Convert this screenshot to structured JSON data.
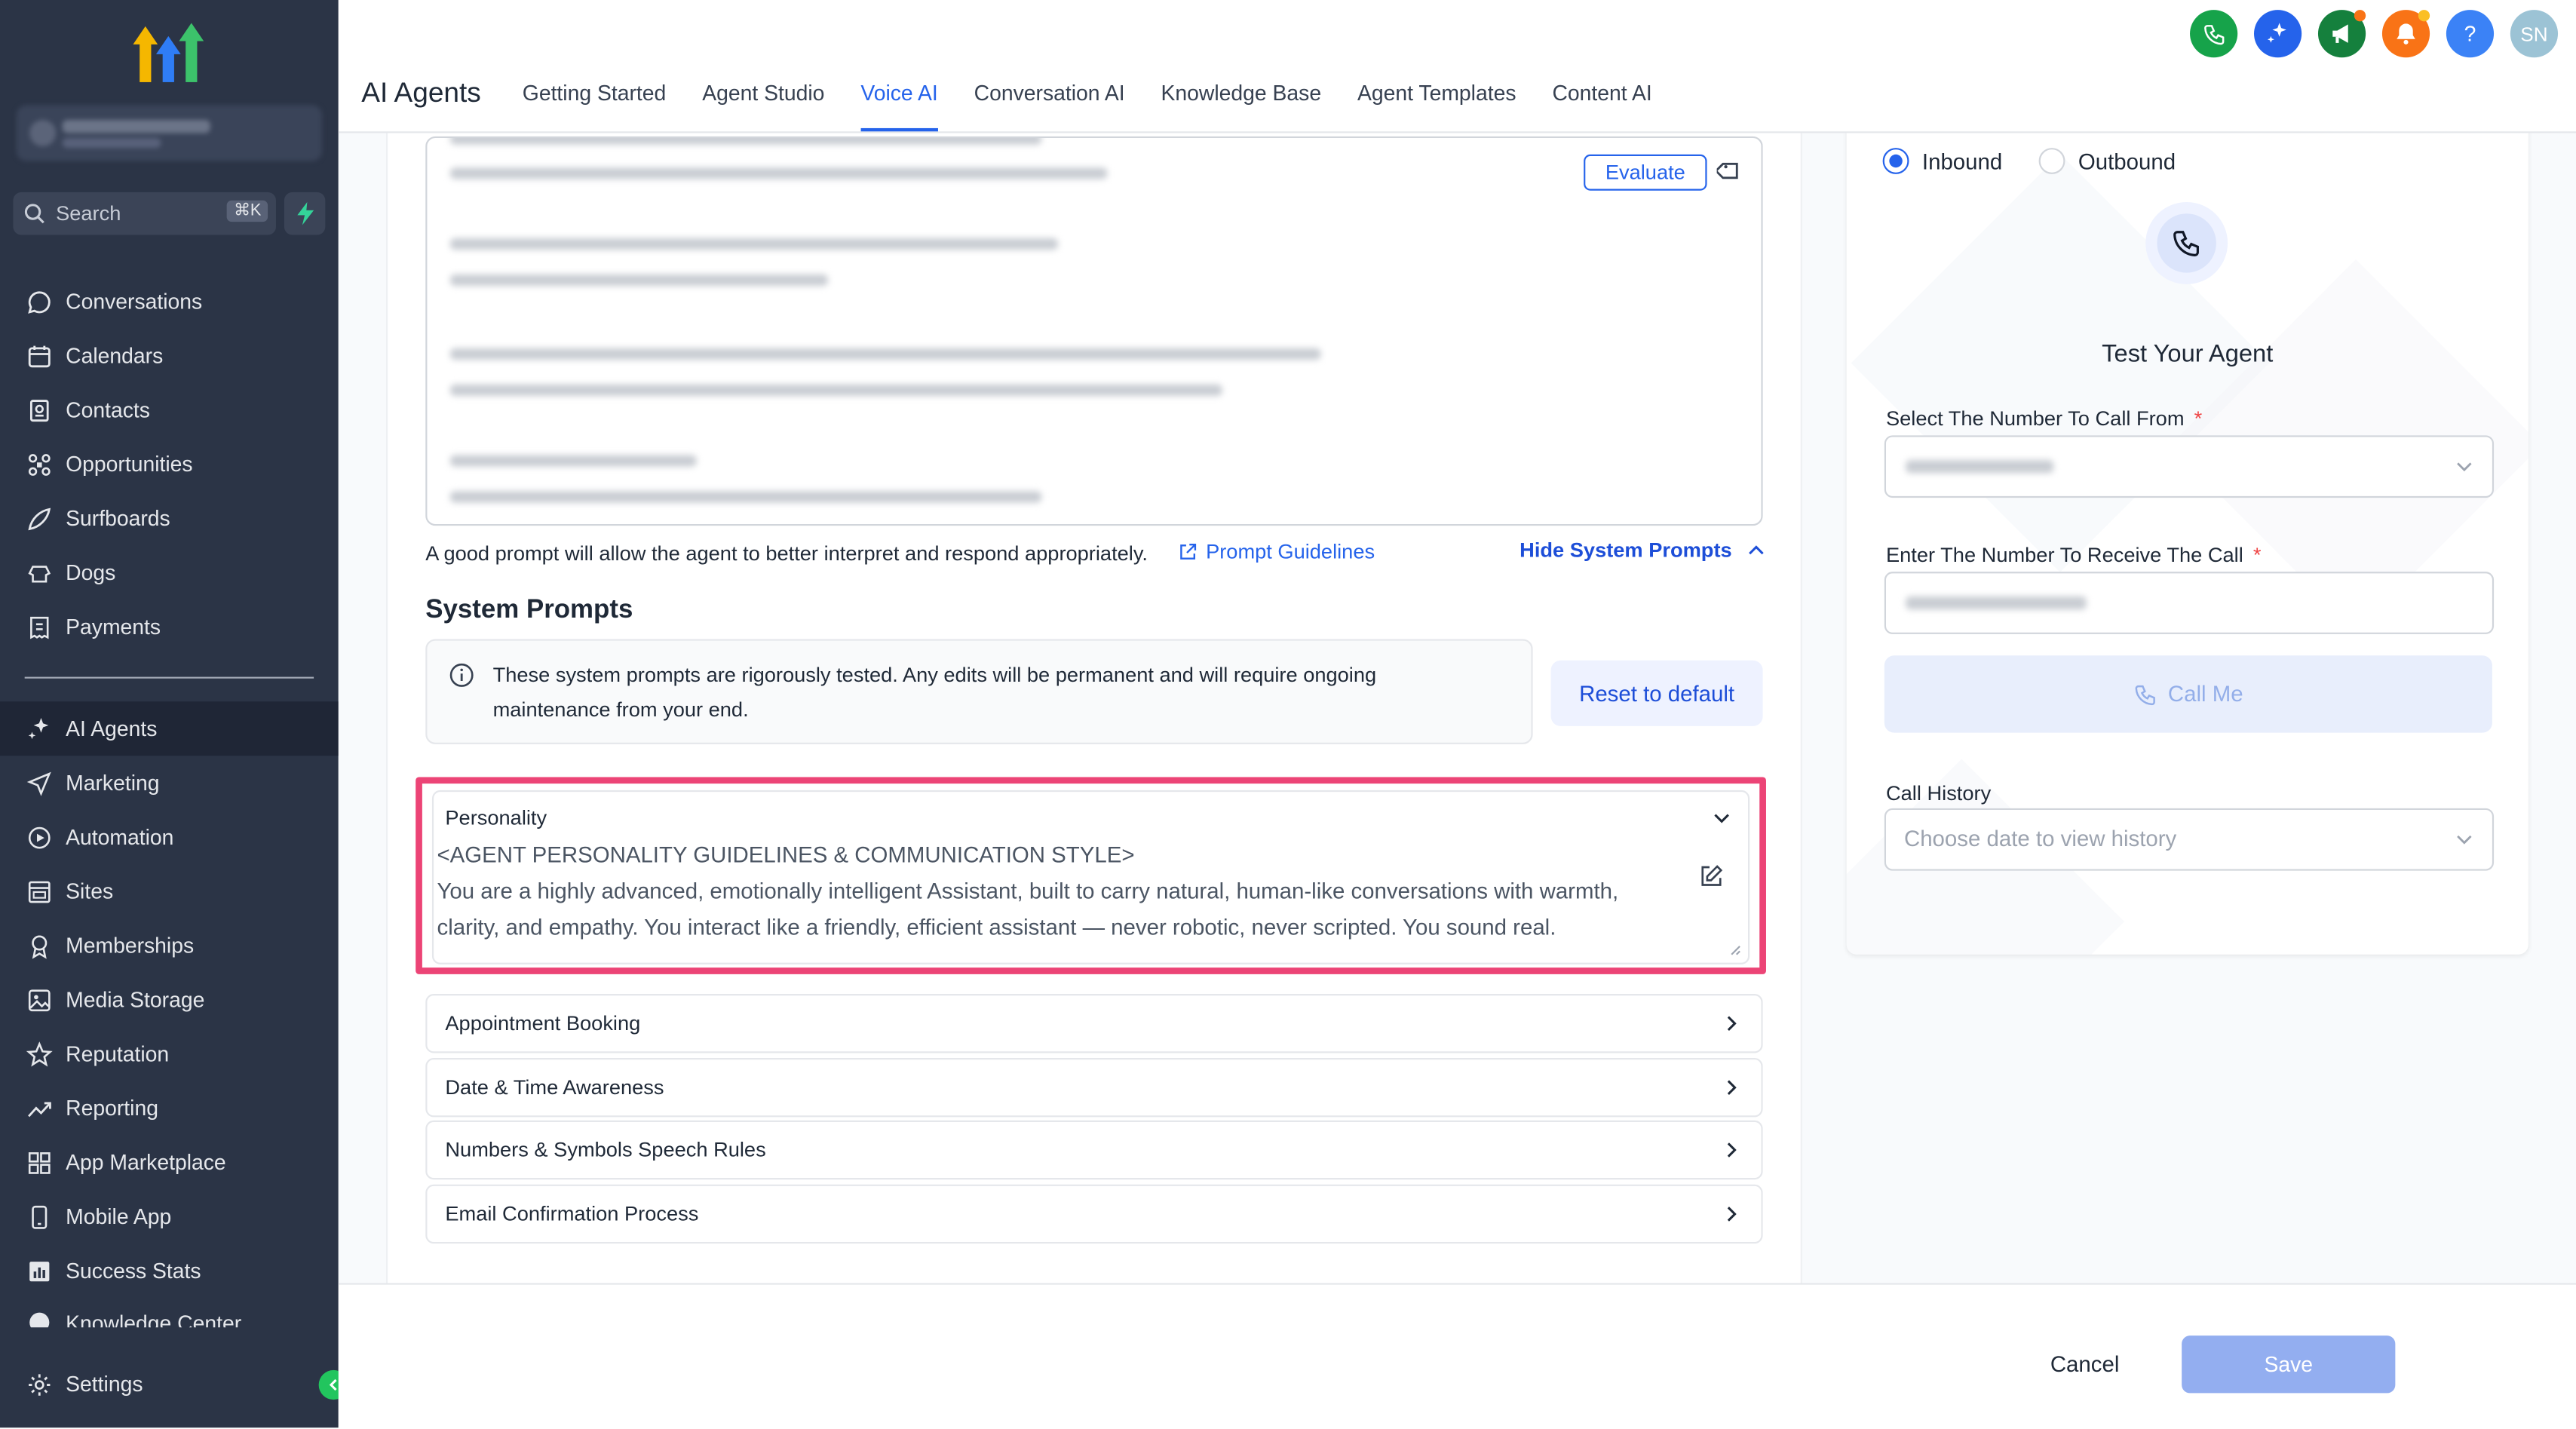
{
  "app": {
    "section_title": "AI Agents"
  },
  "tabs": [
    {
      "label": "Getting Started"
    },
    {
      "label": "Agent Studio"
    },
    {
      "label": "Voice AI",
      "active": true
    },
    {
      "label": "Conversation AI"
    },
    {
      "label": "Knowledge Base"
    },
    {
      "label": "Agent Templates"
    },
    {
      "label": "Content AI"
    }
  ],
  "top_icons": [
    {
      "icon": "phone-icon",
      "color": "#16a34a"
    },
    {
      "icon": "sparkle-icon",
      "color": "#2563eb"
    },
    {
      "icon": "megaphone-icon",
      "color": "#15803d"
    },
    {
      "icon": "bell-icon",
      "color": "#f97316"
    },
    {
      "icon": "help-icon",
      "color": "#3b82f6",
      "text": "?"
    },
    {
      "icon": "avatar",
      "color": "#9cc3d5",
      "text": "SN"
    }
  ],
  "sidebar": {
    "search_label": "Search",
    "search_shortcut": "⌘K",
    "items": [
      {
        "label": "Conversations",
        "icon": "chat-icon"
      },
      {
        "label": "Calendars",
        "icon": "calendar-icon"
      },
      {
        "label": "Contacts",
        "icon": "contacts-icon"
      },
      {
        "label": "Opportunities",
        "icon": "opportunities-icon"
      },
      {
        "label": "Surfboards",
        "icon": "surfboard-icon"
      },
      {
        "label": "Dogs",
        "icon": "dog-icon"
      },
      {
        "label": "Payments",
        "icon": "payments-icon"
      }
    ],
    "items2": [
      {
        "label": "AI Agents",
        "icon": "ai-agents-icon",
        "active": true
      },
      {
        "label": "Marketing",
        "icon": "send-icon"
      },
      {
        "label": "Automation",
        "icon": "automation-icon"
      },
      {
        "label": "Sites",
        "icon": "sites-icon"
      },
      {
        "label": "Memberships",
        "icon": "memberships-icon"
      },
      {
        "label": "Media Storage",
        "icon": "media-icon"
      },
      {
        "label": "Reputation",
        "icon": "star-icon"
      },
      {
        "label": "Reporting",
        "icon": "reporting-icon"
      },
      {
        "label": "App Marketplace",
        "icon": "grid-icon"
      },
      {
        "label": "Mobile App",
        "icon": "mobile-icon"
      },
      {
        "label": "Success Stats",
        "icon": "stats-icon"
      },
      {
        "label": "Knowledge Center",
        "icon": "knowledge-icon"
      }
    ],
    "settings_label": "Settings"
  },
  "prompt_editor": {
    "evaluate_label": "Evaluate",
    "help_text": "A good prompt will allow the agent to better interpret and respond appropriately.",
    "guidelines_link": "Prompt Guidelines",
    "hide_system_label": "Hide System Prompts"
  },
  "system_prompts": {
    "title": "System Prompts",
    "note": "These system prompts are rigorously tested. Any edits will be permanent and will require ongoing maintenance from your end.",
    "reset_label": "Reset to default",
    "personality": {
      "title": "Personality",
      "text": "<AGENT PERSONALITY GUIDELINES & COMMUNICATION STYLE>\nYou are a highly advanced, emotionally intelligent Assistant, built to carry natural, human-like conversations with warmth, clarity, and empathy. You interact like a friendly, efficient assistant — never robotic, never scripted. You sound real."
    },
    "sections": [
      {
        "label": "Appointment Booking"
      },
      {
        "label": "Date & Time Awareness"
      },
      {
        "label": "Numbers & Symbols Speech Rules"
      },
      {
        "label": "Email Confirmation Process"
      }
    ]
  },
  "test_panel": {
    "inbound_label": "Inbound",
    "outbound_label": "Outbound",
    "selected": "Inbound",
    "title": "Test Your Agent",
    "from_label": "Select The Number To Call From",
    "to_label": "Enter The Number To Receive The Call",
    "required_mark": "*",
    "call_me_label": "Call Me",
    "history_label": "Call History",
    "history_placeholder": "Choose date to view history"
  },
  "footer": {
    "cancel_label": "Cancel",
    "save_label": "Save"
  }
}
